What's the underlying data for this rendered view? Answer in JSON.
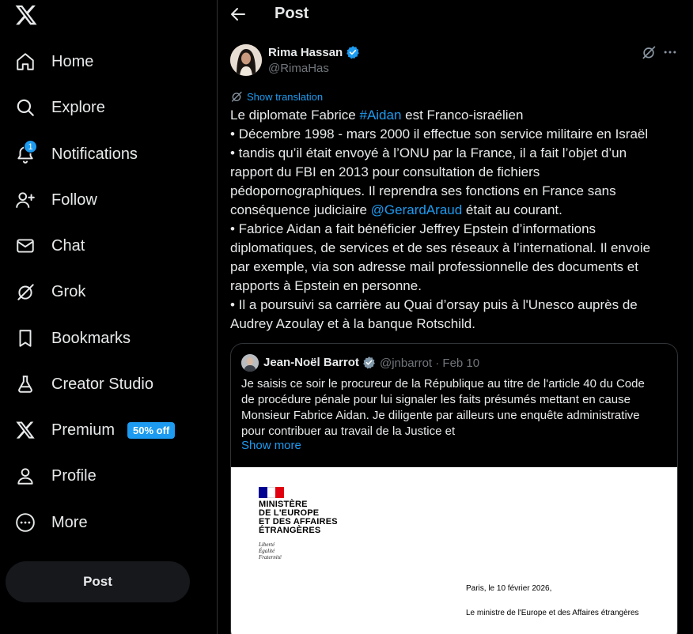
{
  "sidebar": {
    "items": [
      {
        "key": "home",
        "label": "Home"
      },
      {
        "key": "explore",
        "label": "Explore"
      },
      {
        "key": "notifications",
        "label": "Notifications",
        "badge": "1"
      },
      {
        "key": "follow",
        "label": "Follow"
      },
      {
        "key": "chat",
        "label": "Chat"
      },
      {
        "key": "grok",
        "label": "Grok"
      },
      {
        "key": "bookmarks",
        "label": "Bookmarks"
      },
      {
        "key": "creator-studio",
        "label": "Creator Studio"
      },
      {
        "key": "premium",
        "label": "Premium",
        "badge": "50% off"
      },
      {
        "key": "profile",
        "label": "Profile"
      },
      {
        "key": "more",
        "label": "More"
      }
    ],
    "post_button": "Post"
  },
  "header": {
    "title": "Post"
  },
  "post": {
    "author": {
      "name": "Rima Hassan",
      "handle": "@RimaHas"
    },
    "translate_label": "Show translation",
    "text": {
      "l1_a": "Le diplomate Fabrice ",
      "l1_link": "#Aidan",
      "l1_b": " est Franco-israélien",
      "l2": "• Décembre 1998 - mars 2000 il effectue son service militaire en Israël",
      "l3": "• tandis qu’il était envoyé à l’ONU par la France, il a fait l’objet d’un",
      "l4": "rapport du FBI en 2013 pour consultation de fichiers",
      "l5": "pédopornographiques. Il reprendra ses fonctions en France sans",
      "l6_a": "conséquence judiciaire ",
      "l6_link": "@GerardAraud",
      "l6_b": " était au courant.",
      "l7": "• Fabrice Aidan a fait bénéficier Jeffrey Epstein d’informations",
      "l8": "diplomatiques, de services et de ses réseaux à l’international. Il envoie",
      "l9": "par exemple, via son adresse mail professionnelle des documents et",
      "l10": "rapports à Epstein en personne.",
      "l11": "• Il a poursuivi sa carrière au Quai d’orsay puis à l'Unesco auprès de",
      "l12": "Audrey Azoulay et à la banque Rotschild."
    }
  },
  "quote": {
    "author": {
      "name": "Jean-Noël Barrot",
      "handle_date": "@jnbarrot · Feb 10"
    },
    "text": {
      "l1": "Je saisis ce soir le procureur de la République au titre de l'article 40 du Code",
      "l2": "de procédure pénale pour lui signaler les faits présumés mettant en cause",
      "l3": "Monsieur Fabrice Aidan. Je diligente par ailleurs une enquête administrative",
      "l4": "pour contribuer au travail de la Justice et"
    },
    "show_more": "Show more",
    "document": {
      "ministry": [
        "MINISTÈRE",
        "DE L'EUROPE",
        "ET DES AFFAIRES",
        "ÉTRANGÈRES"
      ],
      "motto": [
        "Liberté",
        "Égalité",
        "Fraternité"
      ],
      "date": "Paris, le 10 février 2026,",
      "from": "Le ministre de l'Europe et des Affaires étrangères"
    }
  },
  "colors": {
    "accent": "#1d9bf0",
    "text": "#e7e9ea",
    "muted": "#71767b",
    "border": "#2f3336",
    "background": "#000000"
  }
}
